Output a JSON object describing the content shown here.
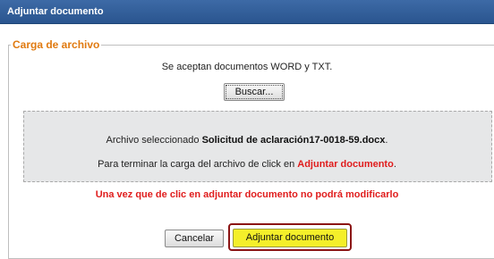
{
  "window": {
    "title": "Adjuntar documento"
  },
  "section": {
    "legend": "Carga de archivo"
  },
  "upload": {
    "accepted_text": "Se aceptan documentos WORD y TXT.",
    "browse_label": "Buscar...",
    "selected_prefix": "Archivo seleccionado",
    "selected_file": "Solicitud de aclaración17-0018-59.docx",
    "selected_suffix": ".",
    "finish_prefix": "Para terminar la carga del archivo de click en",
    "finish_link": "Adjuntar documento",
    "finish_suffix": "."
  },
  "warning": "Una vez que de clic en adjuntar documento no podrá modificarlo",
  "actions": {
    "cancel_label": "Cancelar",
    "attach_label": "Adjuntar documento"
  },
  "colors": {
    "titlebar": "#2f5d99",
    "legend": "#e07a10",
    "alert": "#e01d1d",
    "attach_button": "#f4ef2a",
    "highlight_border": "#8b1414"
  }
}
